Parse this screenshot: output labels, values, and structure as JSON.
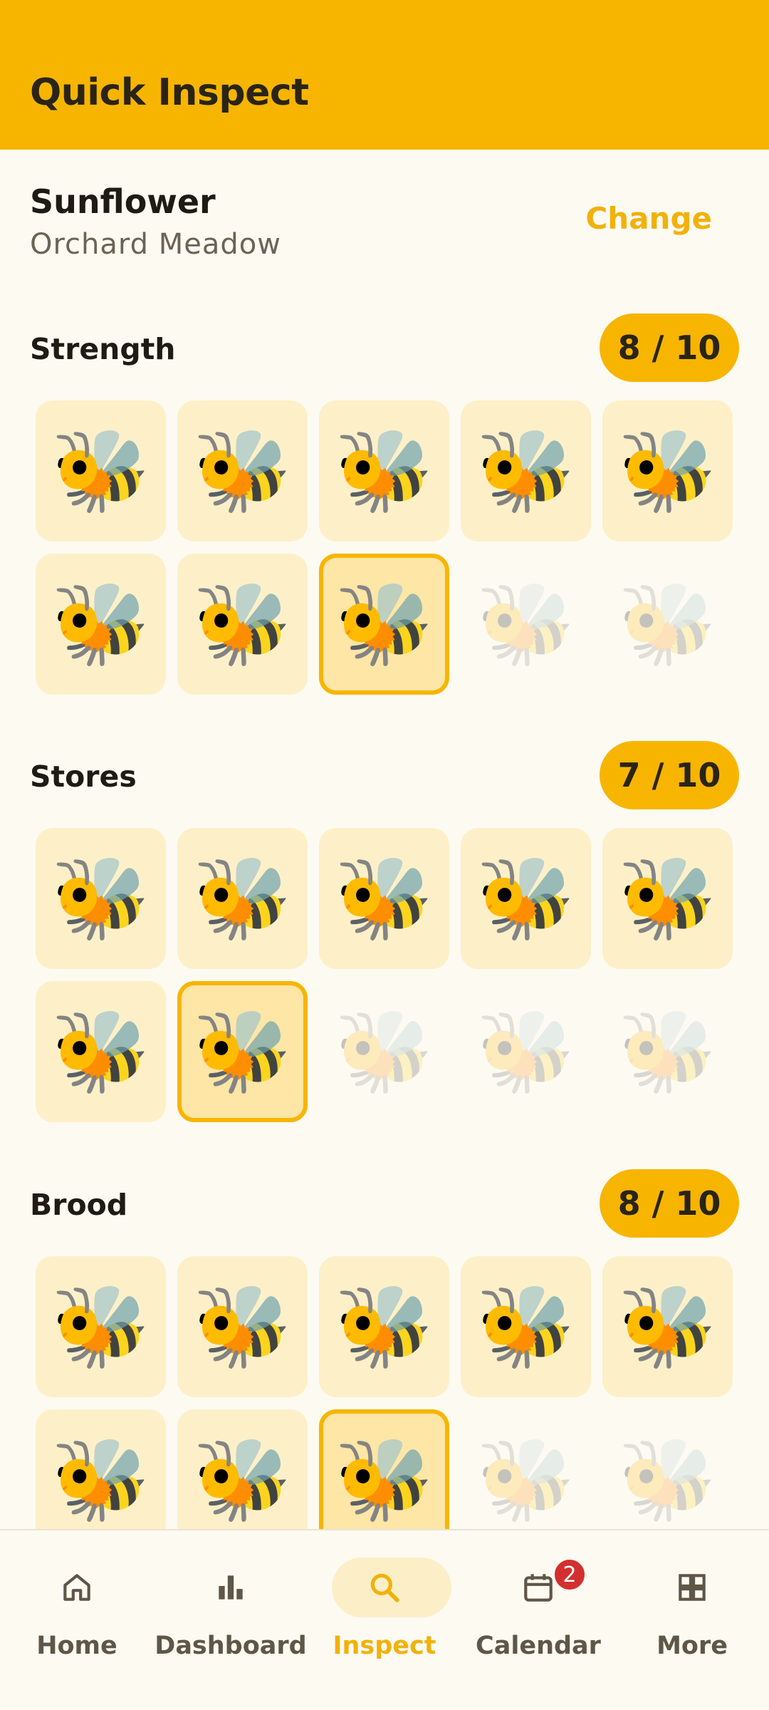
{
  "appbar": {
    "title": "Quick Inspect",
    "color": "#F7B500"
  },
  "hive": {
    "name": "Sunflower",
    "location": "Orchard Meadow",
    "change_label": "Change"
  },
  "bee_glyph": "🐝",
  "sections": [
    {
      "title": "Strength",
      "score_label": "8 / 10",
      "score": 8,
      "max": 10
    },
    {
      "title": "Stores",
      "score_label": "7 / 10",
      "score": 7,
      "max": 10
    },
    {
      "title": "Brood",
      "score_label": "8 / 10",
      "score": 8,
      "max": 10
    }
  ],
  "nav": {
    "items": [
      {
        "label": "Home",
        "icon": "home-icon"
      },
      {
        "label": "Dashboard",
        "icon": "bar-chart-icon"
      },
      {
        "label": "Inspect",
        "icon": "search-icon",
        "active": true
      },
      {
        "label": "Calendar",
        "icon": "calendar-icon",
        "badge": "2"
      },
      {
        "label": "More",
        "icon": "grid-icon"
      }
    ]
  }
}
